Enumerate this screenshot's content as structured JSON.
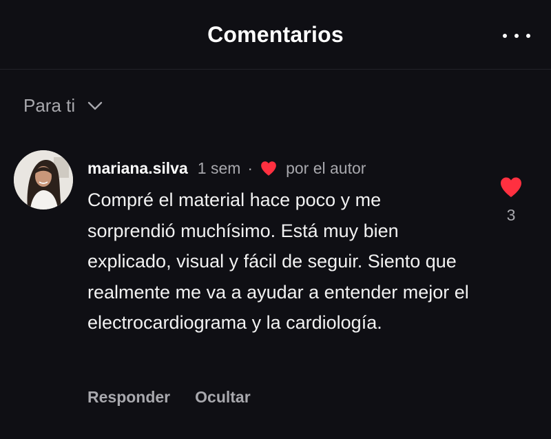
{
  "header": {
    "title": "Comentarios",
    "more_icon": "more-horizontal-icon"
  },
  "filter": {
    "label": "Para ti",
    "icon": "chevron-down-icon"
  },
  "comment": {
    "username": "mariana.silva",
    "time": "1 sem",
    "separator": "·",
    "author_liked_label": "por el autor",
    "author_heart_icon": "heart-icon",
    "text": "Compré el material hace poco y me sorprendió muchísimo. Está muy bien explicado, visual y fácil de seguir. Siento que realmente me va a ayudar a entender mejor el electrocardiograma y la cardiología.",
    "likes": "3",
    "like_icon": "heart-icon",
    "actions": {
      "reply": "Responder",
      "hide": "Ocultar"
    }
  },
  "colors": {
    "background": "#0f0f14",
    "heart": "#ff3040",
    "muted_text": "#a8a8ad",
    "primary_text": "#ffffff"
  }
}
